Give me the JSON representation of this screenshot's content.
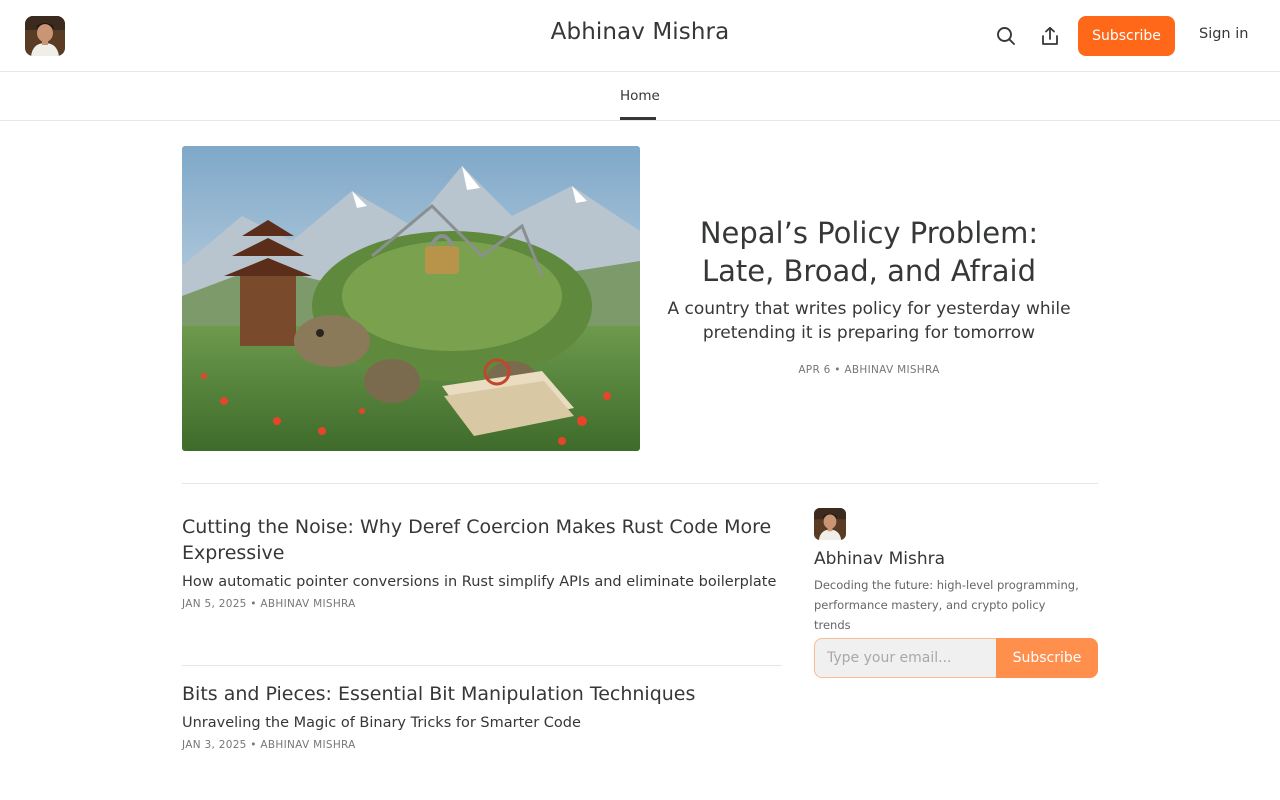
{
  "header": {
    "site_title": "Abhinav Mishra",
    "subscribe_label": "Subscribe",
    "signin_label": "Sign in",
    "icons": [
      "search-icon",
      "share-icon"
    ]
  },
  "nav": {
    "tabs": [
      {
        "label": "Home",
        "active": true
      }
    ]
  },
  "featured": {
    "title": "Nepal’s Policy Problem: Late, Broad, and Afraid",
    "subtitle": "A country that writes policy for yesterday while pretending it is preparing for tomorrow",
    "meta": "APR 6 • ABHINAV MISHRA"
  },
  "posts": [
    {
      "title": "Cutting the Noise: Why Deref Coercion Makes Rust Code More Expressive",
      "subtitle": "How automatic pointer conversions in Rust simplify APIs and eliminate boilerplate",
      "meta": "JAN 5, 2025 • ABHINAV MISHRA"
    },
    {
      "title": "Bits and Pieces: Essential Bit Manipulation Techniques",
      "subtitle": "Unraveling the Magic of Binary Tricks for Smarter Code",
      "meta": "JAN 3, 2025 • ABHINAV MISHRA"
    }
  ],
  "sidebar": {
    "name": "Abhinav Mishra",
    "description": "Decoding the future: high-level programming, performance mastery, and crypto policy trends",
    "email_placeholder": "Type your email...",
    "subscribe_label": "Subscribe"
  },
  "colors": {
    "accent": "#ff6719",
    "accent_light": "#ff8f4d",
    "text": "#363737",
    "border": "#e6e6e6"
  }
}
